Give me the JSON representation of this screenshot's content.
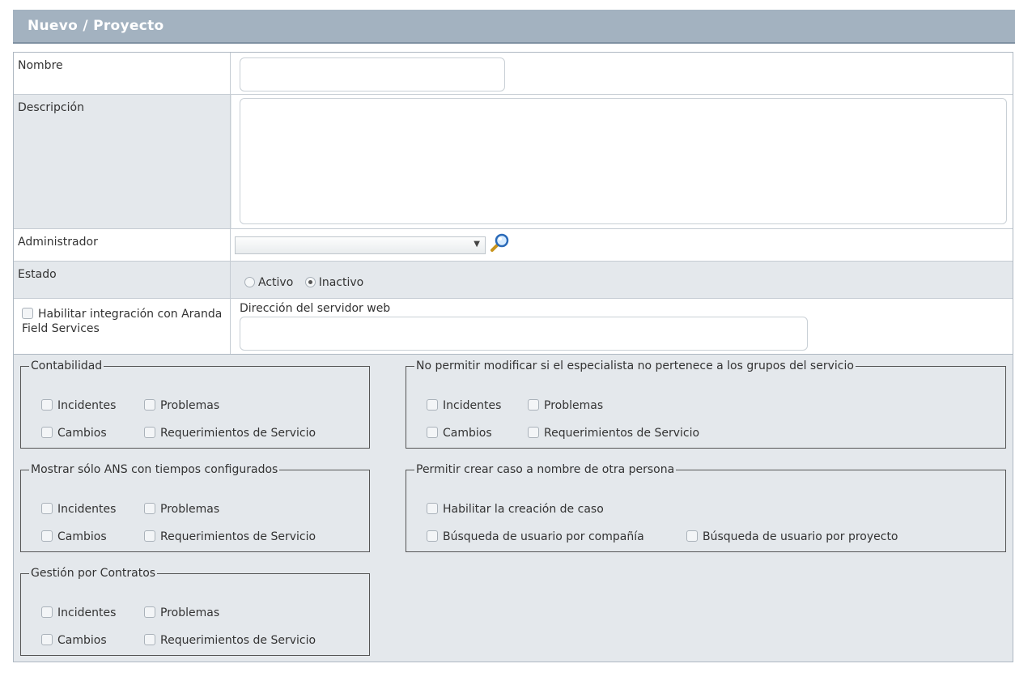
{
  "header": {
    "title": "Nuevo / Proyecto"
  },
  "form": {
    "nombre_label": "Nombre",
    "nombre_value": "",
    "descripcion_label": "Descripción",
    "descripcion_value": "",
    "administrador_label": "Administrador",
    "administrador_value": "",
    "estado_label": "Estado",
    "estado_options": [
      "Activo",
      "Inactivo"
    ],
    "estado_selected": "Inactivo",
    "afs_label": "Habilitar integración con Aranda Field Services",
    "afs_checked": false,
    "servidor_label": "Dirección del servidor web",
    "servidor_value": ""
  },
  "groups": {
    "contabilidad": {
      "legend": "Contabilidad",
      "options": [
        "Incidentes",
        "Problemas",
        "Cambios",
        "Requerimientos de Servicio"
      ]
    },
    "no_permitir": {
      "legend": "No permitir modificar si el especialista no pertenece a los grupos del servicio",
      "options": [
        "Incidentes",
        "Problemas",
        "Cambios",
        "Requerimientos de Servicio"
      ]
    },
    "mostrar_ans": {
      "legend": "Mostrar sólo ANS con tiempos configurados",
      "options": [
        "Incidentes",
        "Problemas",
        "Cambios",
        "Requerimientos de Servicio"
      ]
    },
    "permitir_crear": {
      "legend": "Permitir crear caso a nombre de otra persona",
      "options": [
        "Habilitar la creación de caso",
        "Búsqueda de usuario por compañía",
        "Búsqueda de usuario por proyecto"
      ]
    },
    "gestion_contratos": {
      "legend": "Gestión por Contratos",
      "options": [
        "Incidentes",
        "Problemas",
        "Cambios",
        "Requerimientos de Servicio"
      ]
    }
  },
  "icons": {
    "lookup": "magnifier-icon",
    "dropdown": "chevron-down-icon"
  }
}
